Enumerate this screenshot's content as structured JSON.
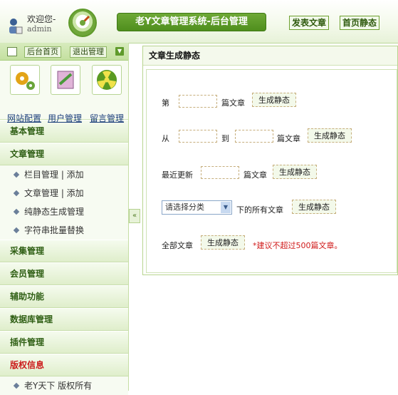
{
  "header": {
    "welcome": "欢迎您-",
    "username": "admin",
    "title": "老Y文章管理系统-后台管理",
    "publish_btn": "发表文章",
    "home_static_btn": "首页静态"
  },
  "sidebar": {
    "toolbar": {
      "home": "后台首页",
      "logout": "退出管理"
    },
    "quick": [
      {
        "label": "网站配置",
        "icon": "gears-icon"
      },
      {
        "label": "用户管理",
        "icon": "users-icon"
      },
      {
        "label": "留言管理",
        "icon": "radiation-icon"
      }
    ],
    "sections": [
      {
        "title": "基本管理",
        "items": []
      },
      {
        "title": "文章管理",
        "items": [
          {
            "text": "栏目管理 | 添加"
          },
          {
            "text": "文章管理 | 添加"
          },
          {
            "text": "纯静态生成管理"
          },
          {
            "text": "字符串批量替换"
          }
        ]
      },
      {
        "title": "采集管理",
        "items": []
      },
      {
        "title": "会员管理",
        "items": []
      },
      {
        "title": "辅助功能",
        "items": []
      },
      {
        "title": "数据库管理",
        "items": []
      },
      {
        "title": "插件管理",
        "items": []
      },
      {
        "title": "版权信息",
        "items": [
          {
            "text": "老Y天下 版权所有"
          }
        ]
      }
    ],
    "collapse_glyph": "«"
  },
  "main": {
    "title": "文章生成静态",
    "row1": {
      "prefix": "第",
      "suffix": "篇文章",
      "button": "生成静态"
    },
    "row2": {
      "from": "从",
      "to": "到",
      "suffix": "篇文章",
      "button": "生成静态"
    },
    "row3": {
      "prefix": "最近更新",
      "suffix": "篇文章",
      "button": "生成静态"
    },
    "row4": {
      "select": "请选择分类",
      "suffix": "下的所有文章",
      "button": "生成静态"
    },
    "row5": {
      "prefix": "全部文章",
      "button": "生成静态",
      "note": "*建议不超过500篇文章。"
    }
  }
}
